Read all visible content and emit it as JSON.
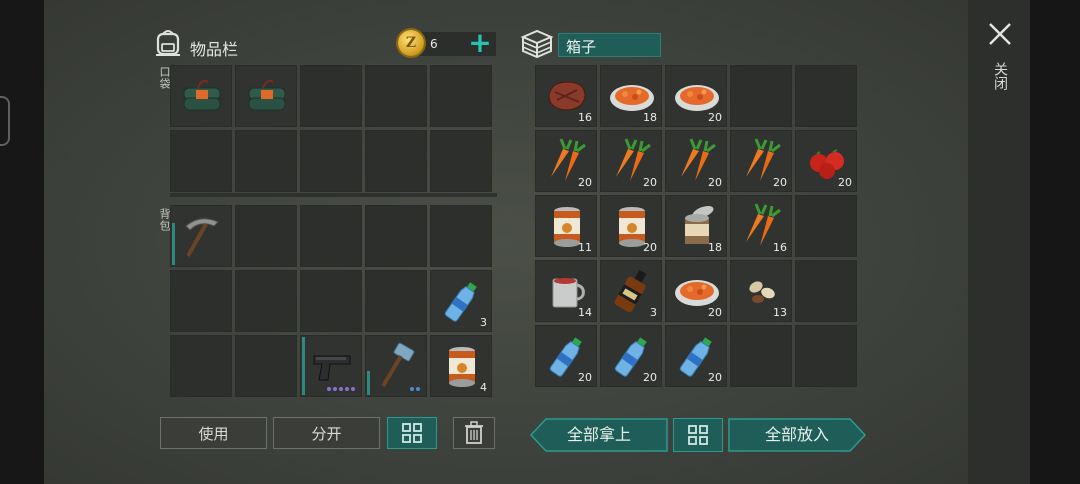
{
  "inventory": {
    "title": "物品栏",
    "pocket_label": "口袋",
    "backpack_label": "背包",
    "coins": "6",
    "pocket_slots": [
      {
        "item": "dynamite-pack",
        "count": ""
      },
      {
        "item": "dynamite-pack",
        "count": ""
      },
      {
        "item": "",
        "count": ""
      },
      {
        "item": "",
        "count": ""
      },
      {
        "item": "",
        "count": ""
      },
      {
        "item": "",
        "count": ""
      },
      {
        "item": "",
        "count": ""
      },
      {
        "item": "",
        "count": ""
      },
      {
        "item": "",
        "count": ""
      },
      {
        "item": "",
        "count": ""
      }
    ],
    "backpack_slots": [
      {
        "item": "pickaxe",
        "count": ""
      },
      {
        "item": "",
        "count": ""
      },
      {
        "item": "",
        "count": ""
      },
      {
        "item": "",
        "count": ""
      },
      {
        "item": "",
        "count": ""
      },
      {
        "item": "",
        "count": ""
      },
      {
        "item": "",
        "count": ""
      },
      {
        "item": "",
        "count": ""
      },
      {
        "item": "",
        "count": ""
      },
      {
        "item": "water-bottle",
        "count": "3"
      },
      {
        "item": "",
        "count": ""
      },
      {
        "item": "",
        "count": ""
      },
      {
        "item": "pistol",
        "count": ""
      },
      {
        "item": "hammer",
        "count": ""
      },
      {
        "item": "canned-food",
        "count": "4"
      }
    ],
    "buttons": {
      "use": "使用",
      "split": "分开"
    }
  },
  "container": {
    "title": "箱子",
    "slots": [
      {
        "item": "steak",
        "count": "16"
      },
      {
        "item": "stew-bowl",
        "count": "18"
      },
      {
        "item": "stew-bowl",
        "count": "20"
      },
      {
        "item": "",
        "count": ""
      },
      {
        "item": "",
        "count": ""
      },
      {
        "item": "carrots",
        "count": "20"
      },
      {
        "item": "carrots",
        "count": "20"
      },
      {
        "item": "carrots",
        "count": "20"
      },
      {
        "item": "carrots",
        "count": "20"
      },
      {
        "item": "tomatoes",
        "count": "20"
      },
      {
        "item": "canned-food",
        "count": "11"
      },
      {
        "item": "canned-food",
        "count": "20"
      },
      {
        "item": "open-can",
        "count": "18"
      },
      {
        "item": "carrots",
        "count": "16"
      },
      {
        "item": "",
        "count": ""
      },
      {
        "item": "tea-mug",
        "count": "14"
      },
      {
        "item": "whiskey-bottle",
        "count": "3"
      },
      {
        "item": "stew-bowl",
        "count": "20"
      },
      {
        "item": "seeds",
        "count": "13"
      },
      {
        "item": "",
        "count": ""
      },
      {
        "item": "water-bottle",
        "count": "20"
      },
      {
        "item": "water-bottle",
        "count": "20"
      },
      {
        "item": "water-bottle",
        "count": "20"
      },
      {
        "item": "",
        "count": ""
      },
      {
        "item": "",
        "count": ""
      }
    ],
    "take_all": "全部拿上",
    "put_all": "全部放入"
  },
  "close_label": "关闭",
  "colors": {
    "accent": "#27c2b0",
    "teal_button": "#1f5e58",
    "slot": "#30332f",
    "panel": "#42463f"
  }
}
